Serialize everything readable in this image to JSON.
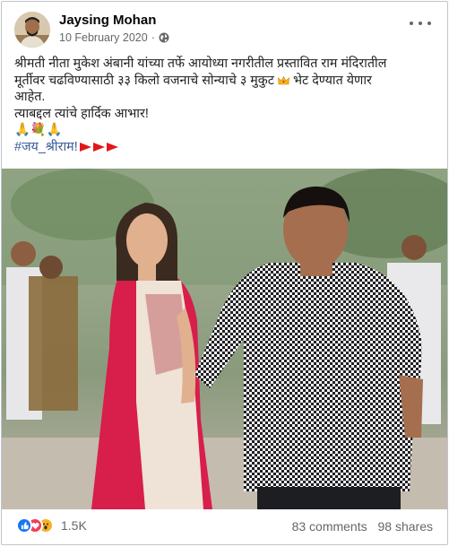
{
  "post": {
    "author": "Jaysing Mohan",
    "date": "10 February 2020",
    "privacy_sep": "·",
    "text_line1": "श्रीमती नीता मुकेश अंबानी यांच्या तर्फे आयोध्या नगरीतील प्रस्तावित राम मंदिरातील",
    "text_line2a": "मूर्तीवर चढविण्यासाठी ३३ किलो वजनाचे सोन्याचे ३ मुकुट",
    "text_line2b": "भेट देण्यात येणार",
    "text_line3": "आहेत.",
    "text_line4": "त्याबद्दल त्यांचे हार्दिक आभार!",
    "text_line5": "🙏💐🙏",
    "hashtag": "#जय_श्रीराम!"
  },
  "reactions": {
    "count": "1.5K",
    "types": [
      "like-icon",
      "love-icon",
      "wow-icon"
    ],
    "colors": {
      "like": "#1877f2",
      "love": "#f33e58",
      "wow": "#f7b125"
    }
  },
  "stats": {
    "comments": "83 comments",
    "shares": "98 shares"
  },
  "accent": {
    "hashtag": "#385898",
    "flag": "#e0171a"
  }
}
